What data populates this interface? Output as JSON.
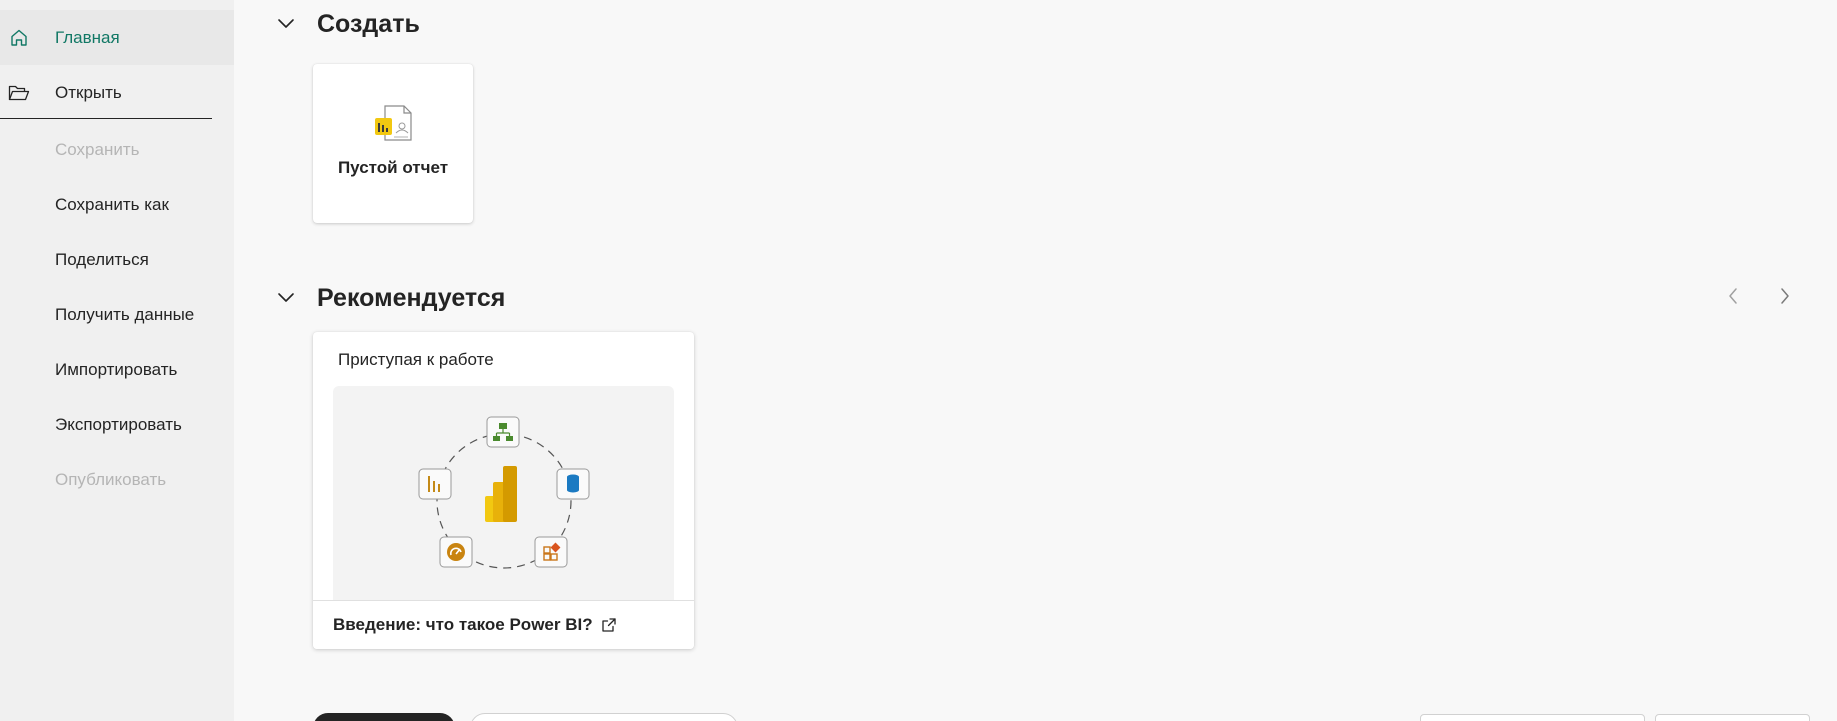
{
  "sidebar": {
    "items": [
      {
        "label": "Главная",
        "icon": "home-icon",
        "state": "active"
      },
      {
        "label": "Открыть",
        "icon": "folder-open-icon",
        "state": "normal"
      },
      {
        "label": "Сохранить",
        "icon": "",
        "state": "disabled"
      },
      {
        "label": "Сохранить как",
        "icon": "",
        "state": "normal"
      },
      {
        "label": "Поделиться",
        "icon": "",
        "state": "normal"
      },
      {
        "label": "Получить данные",
        "icon": "",
        "state": "normal"
      },
      {
        "label": "Импортировать",
        "icon": "",
        "state": "normal"
      },
      {
        "label": "Экспортировать",
        "icon": "",
        "state": "normal"
      },
      {
        "label": "Опубликовать",
        "icon": "",
        "state": "disabled"
      }
    ]
  },
  "create_section": {
    "title": "Создать",
    "blank_report": {
      "label": "Пустой отчет",
      "icon": "blank-report-icon"
    }
  },
  "recommended_section": {
    "title": "Рекомендуется",
    "card": {
      "caption": "Приступая к работе",
      "link_text": "Введение: что такое Power BI?",
      "link_icon": "external-link-icon",
      "illustration_icons": [
        "hierarchy-icon",
        "database-icon",
        "add-visual-icon",
        "gauge-icon",
        "bar-chart-icon",
        "power-bi-logo"
      ]
    },
    "pager": {
      "prev_icon": "chevron-left-icon",
      "next_icon": "chevron-right-icon"
    }
  },
  "colors": {
    "accent_green": "#117865",
    "sidebar_bg": "#f0f0f0",
    "main_bg": "#f8f8f8",
    "disabled_text": "#b5b5b5",
    "powerbi_yellow": "#f2c811"
  }
}
